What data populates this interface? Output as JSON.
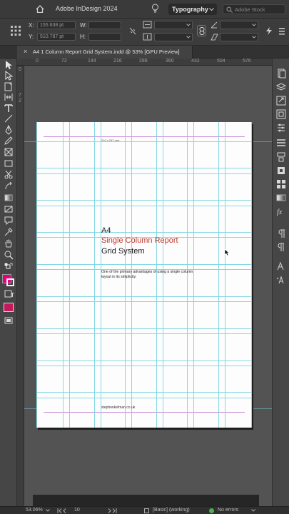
{
  "app": {
    "title": "Adobe InDesign 2024",
    "workspace": "Typography",
    "stock_search_placeholder": "Adobe Stock"
  },
  "control": {
    "x_label": "X:",
    "x_value": "155.638 pt",
    "y_label": "Y:",
    "y_value": "510.787 pt",
    "w_label": "W:",
    "h_label": "H:"
  },
  "document_tab": {
    "close": "×",
    "title": "A4 1 Column Report Grid System.indd @ 53% [GPU Preview]"
  },
  "ruler": {
    "h_marks": [
      "0",
      "72",
      "144",
      "216",
      "288",
      "360",
      "432",
      "504",
      "576"
    ],
    "v_marks": [
      "0",
      "7",
      "2"
    ]
  },
  "page": {
    "tiny_size_label": "210 x 297 mm",
    "heading_1": "A4",
    "heading_2": "Single Column Report",
    "heading_3": "Grid System",
    "body": "One of the primary advantages of using a single column layout is its simplicity.",
    "footer": "stephenkelman.co.uk"
  },
  "status": {
    "zoom": "53.06%",
    "page_number": "10",
    "style": "[Basic] (working)",
    "preflight": "No errors"
  },
  "colors": {
    "accent": "#c0392b",
    "guide": "#7ad3e2",
    "fill_swatch": "#e6007e",
    "stroke_swatch": "#c4195a",
    "ok": "#4caf50"
  }
}
